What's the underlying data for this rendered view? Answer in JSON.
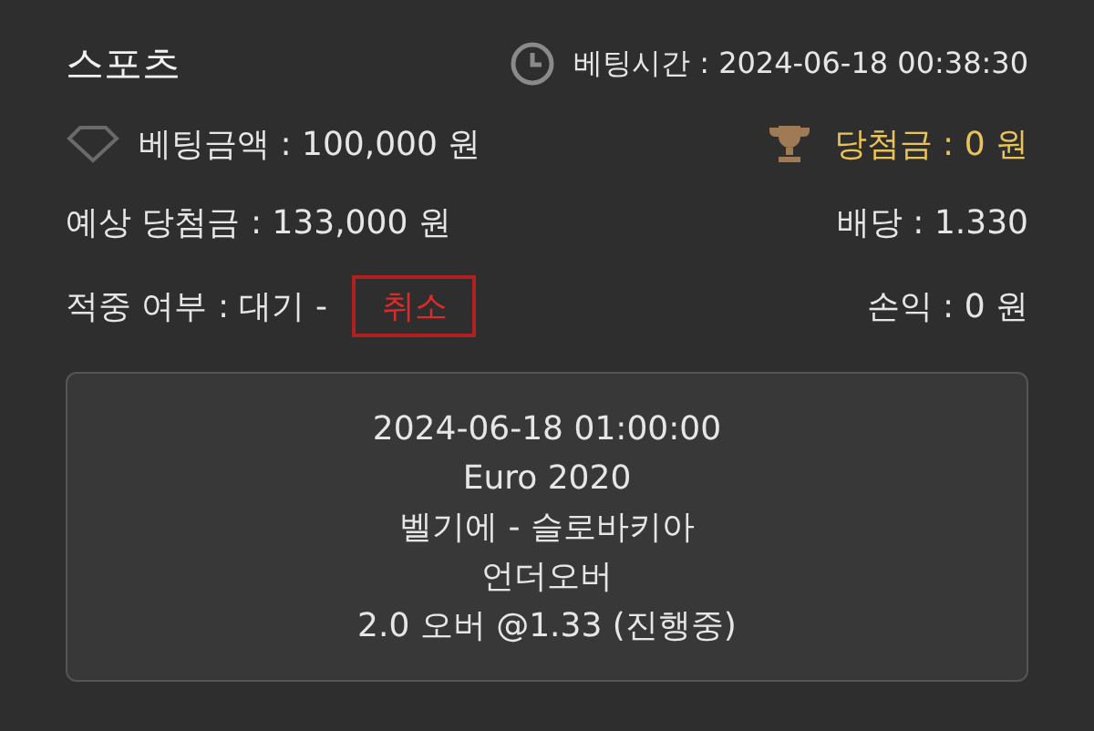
{
  "title": "스포츠",
  "bet_time": "베팅시간 : 2024-06-18 00:38:30",
  "bet_amount": "베팅금액 : 100,000 원",
  "winnings": "당첨금 : 0 원",
  "expected_winnings": "예상 당첨금 : 133,000 원",
  "odds": "배당 : 1.330",
  "result": "적중 여부 : 대기 -",
  "cancel_button": "취소",
  "profit": "손익 : 0 원",
  "details": [
    "2024-06-18 01:00:00",
    "Euro 2020",
    "벨기에 - 슬로바키아",
    "언더오버",
    "2.0 오버 @1.33 (진행중)"
  ]
}
